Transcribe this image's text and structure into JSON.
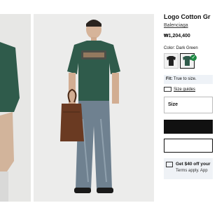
{
  "product": {
    "title": "Logo Cotton Gr",
    "brand": "Balenciaga",
    "price": "₩1,204,400",
    "color_label": "Color: Dark Green",
    "fit_label": "Fit:",
    "fit_value": "True to size.",
    "size_guide": "Size guides",
    "size_placeholder": "Size"
  },
  "promo": {
    "title": "Get $40 off your",
    "subtitle": "Terms apply. App"
  },
  "colors": {
    "shirt": "#2f5b4b",
    "jeans": "#6f8190",
    "bag": "#6a3a22",
    "accent": "#1f8a44"
  }
}
